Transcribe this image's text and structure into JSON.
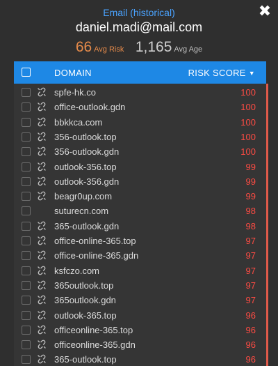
{
  "header": {
    "subtitle": "Email (historical)",
    "email": "daniel.madi@mail.com",
    "avg_risk_value": "66",
    "avg_risk_label": "Avg Risk",
    "avg_age_value": "1,165",
    "avg_age_label": "Avg Age",
    "close_icon": "close-icon"
  },
  "table": {
    "col_domain": "DOMAIN",
    "col_score": "RISK SCORE",
    "sort_icon": "caret-down-icon",
    "link_icon": "broken-link-icon",
    "rows": [
      {
        "domain": "spfe-hk.co",
        "score": "100",
        "link": true
      },
      {
        "domain": "office-outlook.gdn",
        "score": "100",
        "link": true
      },
      {
        "domain": "bbkkca.com",
        "score": "100",
        "link": true
      },
      {
        "domain": "356-outlook.top",
        "score": "100",
        "link": true
      },
      {
        "domain": "356-outlook.gdn",
        "score": "100",
        "link": true
      },
      {
        "domain": "outlook-356.top",
        "score": "99",
        "link": true
      },
      {
        "domain": "outlook-356.gdn",
        "score": "99",
        "link": true
      },
      {
        "domain": "beagr0up.com",
        "score": "99",
        "link": true
      },
      {
        "domain": "suturecn.com",
        "score": "98",
        "link": false
      },
      {
        "domain": "365-outlook.gdn",
        "score": "98",
        "link": true
      },
      {
        "domain": "office-online-365.top",
        "score": "97",
        "link": true
      },
      {
        "domain": "office-online-365.gdn",
        "score": "97",
        "link": true
      },
      {
        "domain": "ksfczo.com",
        "score": "97",
        "link": true
      },
      {
        "domain": "365outlook.top",
        "score": "97",
        "link": true
      },
      {
        "domain": "365outlook.gdn",
        "score": "97",
        "link": true
      },
      {
        "domain": "outlook-365.top",
        "score": "96",
        "link": true
      },
      {
        "domain": "officeonline-365.top",
        "score": "96",
        "link": true
      },
      {
        "domain": "officeonline-365.gdn",
        "score": "96",
        "link": true
      },
      {
        "domain": "365-outlook.top",
        "score": "96",
        "link": true
      }
    ]
  },
  "colors": {
    "accent": "#1e88e5",
    "title_blue": "#4aa3ff",
    "risk_orange": "#e58a4a",
    "score_red": "#ff4b43",
    "background": "#2f2f2f"
  }
}
